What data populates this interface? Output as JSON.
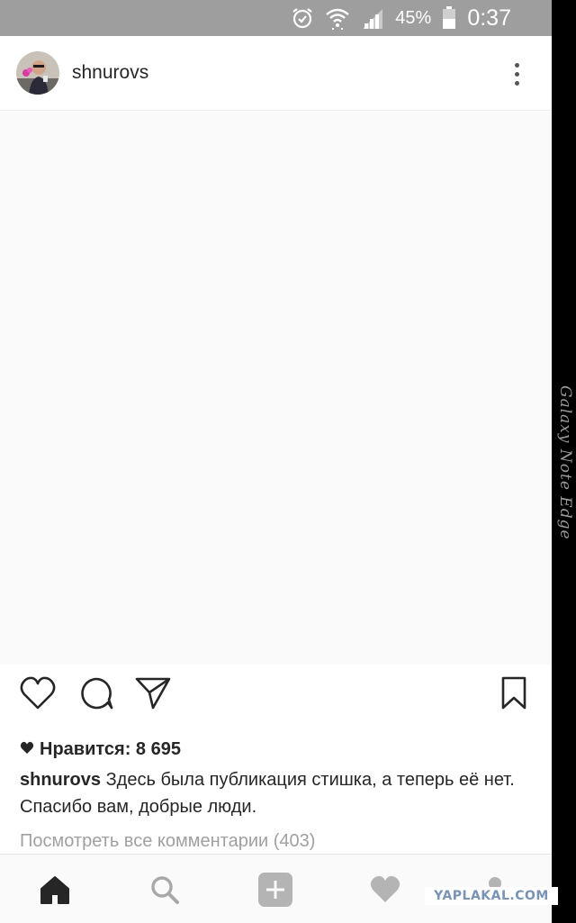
{
  "status_bar": {
    "battery_percent": "45%",
    "time": "0:37",
    "icons": [
      "alarm-icon",
      "wifi-icon",
      "signal-icon",
      "battery-icon"
    ]
  },
  "edge_panel": {
    "label": "Galaxy Note Edge"
  },
  "post": {
    "username": "shnurovs",
    "likes_text": "Нравится: 8 695",
    "caption_user": "shnurovs",
    "caption_text": "Здесь была публикация стишка, а теперь её нет. Спасибо вам, добрые люди.",
    "view_comments": "Посмотреть все комментарии (403)"
  },
  "bottom_nav": {
    "items": [
      "home-icon",
      "search-icon",
      "add-post-icon",
      "activity-heart-icon",
      "profile-icon"
    ]
  },
  "watermark": {
    "text": "YAPLAKAL.COM"
  },
  "colors": {
    "status_bar_bg": "#9e9e9e",
    "text_primary": "#262626",
    "text_secondary": "#a0a0a0",
    "watermark": "#7a93b5"
  }
}
